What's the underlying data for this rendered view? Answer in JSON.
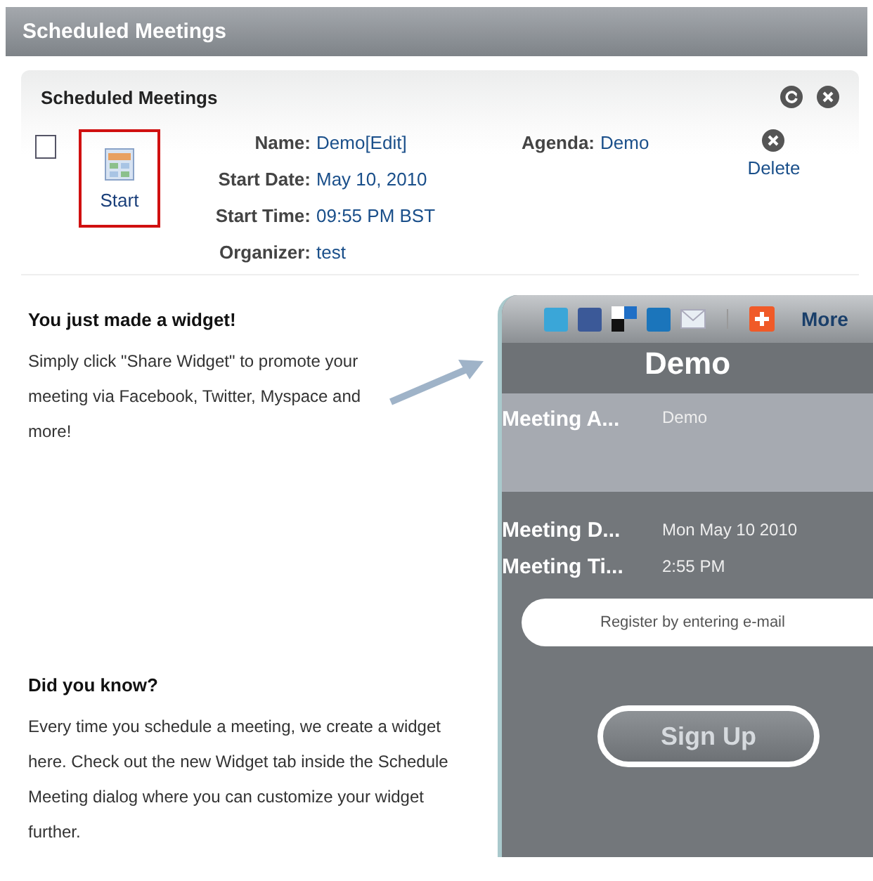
{
  "window": {
    "title": "Scheduled Meetings"
  },
  "panel": {
    "title": "Scheduled Meetings",
    "meeting": {
      "checked": false,
      "start": {
        "label": "Start",
        "highlighted": true
      },
      "fields": [
        {
          "label": "Name:",
          "value": "Demo",
          "link": "[Edit]"
        },
        {
          "label": "Start Date:",
          "value": "May 10, 2010"
        },
        {
          "label": "Start Time:",
          "value": "09:55 PM BST"
        },
        {
          "label": "Organizer:",
          "value": "test"
        }
      ],
      "agenda": {
        "label": "Agenda:",
        "value": "Demo"
      },
      "delete": {
        "label": "Delete"
      }
    }
  },
  "tip": {
    "title": "You just made a widget!",
    "text": "Simply click \"Share Widget\" to promote your meeting via Facebook, Twitter, Myspace and more!"
  },
  "did_you_know": {
    "title": "Did you know?",
    "text": "Every time you schedule a meeting, we create a widget here. Check out the new Widget tab inside the Schedule Meeting dialog where you can customize your widget further."
  },
  "widget": {
    "share_more": "More",
    "title": "Demo",
    "rows": [
      {
        "label": "Meeting A...",
        "value": "Demo",
        "kind": "light"
      },
      {
        "label": "Meeting D...",
        "value": "Mon May 10 2010",
        "kind": "dark"
      },
      {
        "label": "Meeting Ti...",
        "value": "2:55 PM",
        "kind": "dark"
      }
    ],
    "email": {
      "placeholder": "Register by entering e-mail"
    },
    "signup": {
      "label": "Sign Up",
      "disabled": true
    }
  }
}
